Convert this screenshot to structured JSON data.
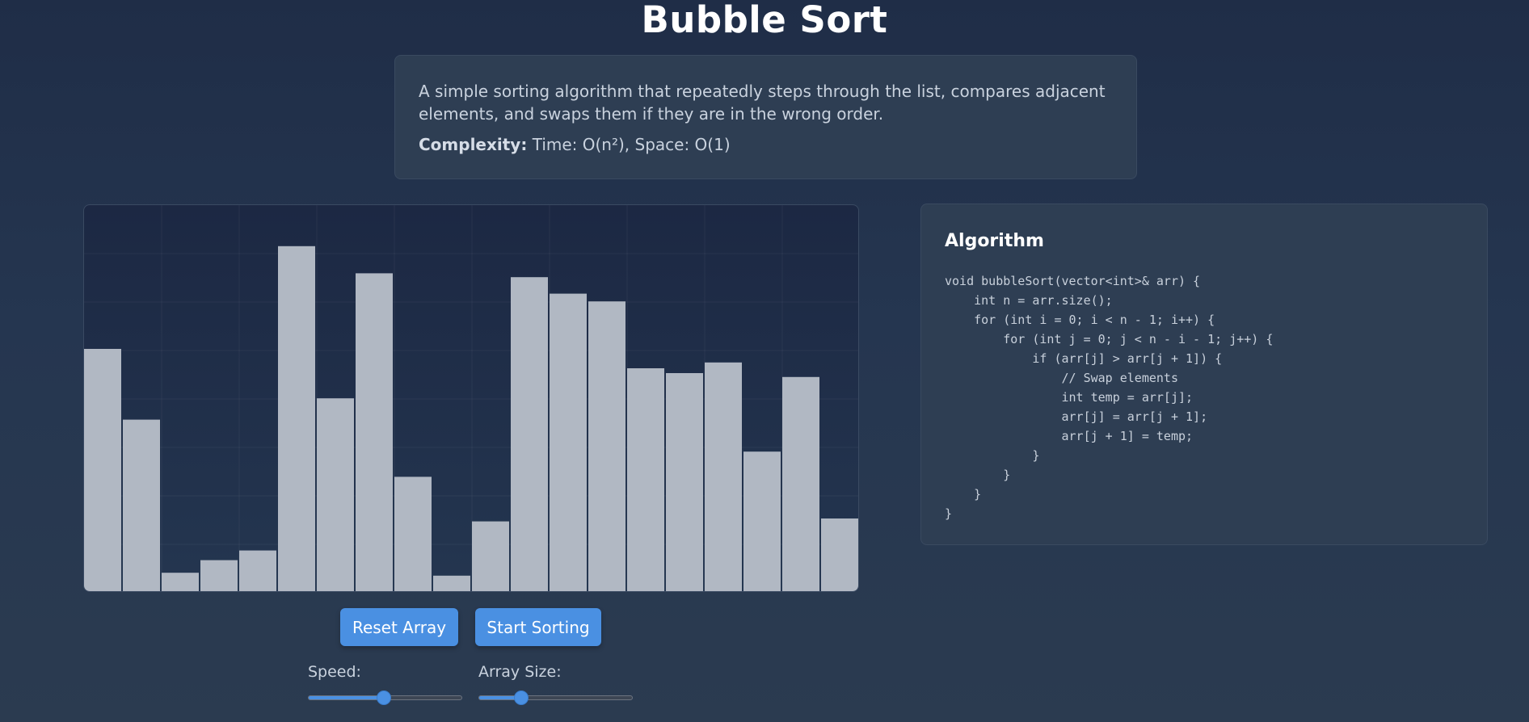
{
  "header": {
    "title": "Bubble Sort"
  },
  "description": {
    "text": "A simple sorting algorithm that repeatedly steps through the list, compares adjacent elements, and swaps them if they are in the wrong order.",
    "complexity_label": "Complexity:",
    "complexity_value": " Time: O(n²), Space: O(1)"
  },
  "visualizer": {
    "bar_color": "#b1b8c3",
    "bar_values": [
      250,
      177,
      19,
      32,
      42,
      356,
      199,
      328,
      118,
      16,
      72,
      324,
      307,
      299,
      230,
      225,
      236,
      144,
      221,
      75
    ]
  },
  "controls": {
    "reset_label": "Reset Array",
    "start_label": "Start Sorting",
    "speed_label": "Speed:",
    "speed_fraction": 0.49,
    "size_label": "Array Size:",
    "size_fraction": 0.28
  },
  "algorithm": {
    "title": "Algorithm",
    "code": "void bubbleSort(vector<int>& arr) {\n    int n = arr.size();\n    for (int i = 0; i < n - 1; i++) {\n        for (int j = 0; j < n - i - 1; j++) {\n            if (arr[j] > arr[j + 1]) {\n                // Swap elements\n                int temp = arr[j];\n                arr[j] = arr[j + 1];\n                arr[j + 1] = temp;\n            }\n        }\n    }\n}"
  },
  "colors": {
    "accent": "#4a90e2",
    "background": "#243450",
    "card": "#2e3e53"
  }
}
